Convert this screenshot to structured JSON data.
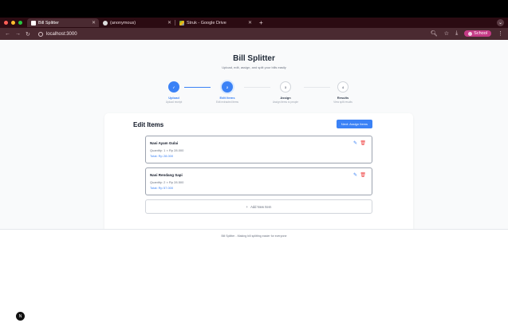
{
  "browser": {
    "tabs": [
      {
        "title": "Bill Splitter",
        "active": true
      },
      {
        "title": "(anonymous)",
        "active": false
      },
      {
        "title": "Struk - Google Drive",
        "active": false
      }
    ],
    "new_tab": "+",
    "url": "localhost:3000",
    "profile": "School",
    "colors": {
      "chrome": "#2b0b12",
      "toolbar": "#4a2a31",
      "profile": "#c53b86"
    }
  },
  "app": {
    "title": "Bill Splitter",
    "subtitle": "Upload, edit, assign, and split your bills easily"
  },
  "steps": [
    {
      "number": "✓",
      "label": "Upload",
      "desc": "Upload receipt",
      "state": "done"
    },
    {
      "number": "2",
      "label": "Edit Items",
      "desc": "Edit extracted items",
      "state": "current"
    },
    {
      "number": "3",
      "label": "Assign",
      "desc": "Assign items to people",
      "state": "todo"
    },
    {
      "number": "4",
      "label": "Results",
      "desc": "View split results",
      "state": "todo"
    }
  ],
  "edit_items": {
    "title": "Edit Items",
    "next_button": "Next: Assign Items",
    "items": [
      {
        "name": "Nasi Ayam Gulai",
        "quantity": "Quantity: 1 × Rp 28.000",
        "total": "Total: Rp 28.000"
      },
      {
        "name": "Nasi Rendang Sapi",
        "quantity": "Quantity: 2 × Rp 28.500",
        "total": "Total: Rp 57.000"
      }
    ],
    "add_button": "Add New Item",
    "add_icon": "+"
  },
  "footer": "Bill Splitter - Making bill splitting easier for everyone",
  "accent_color": "#3b82f6",
  "dev_badge": "N"
}
